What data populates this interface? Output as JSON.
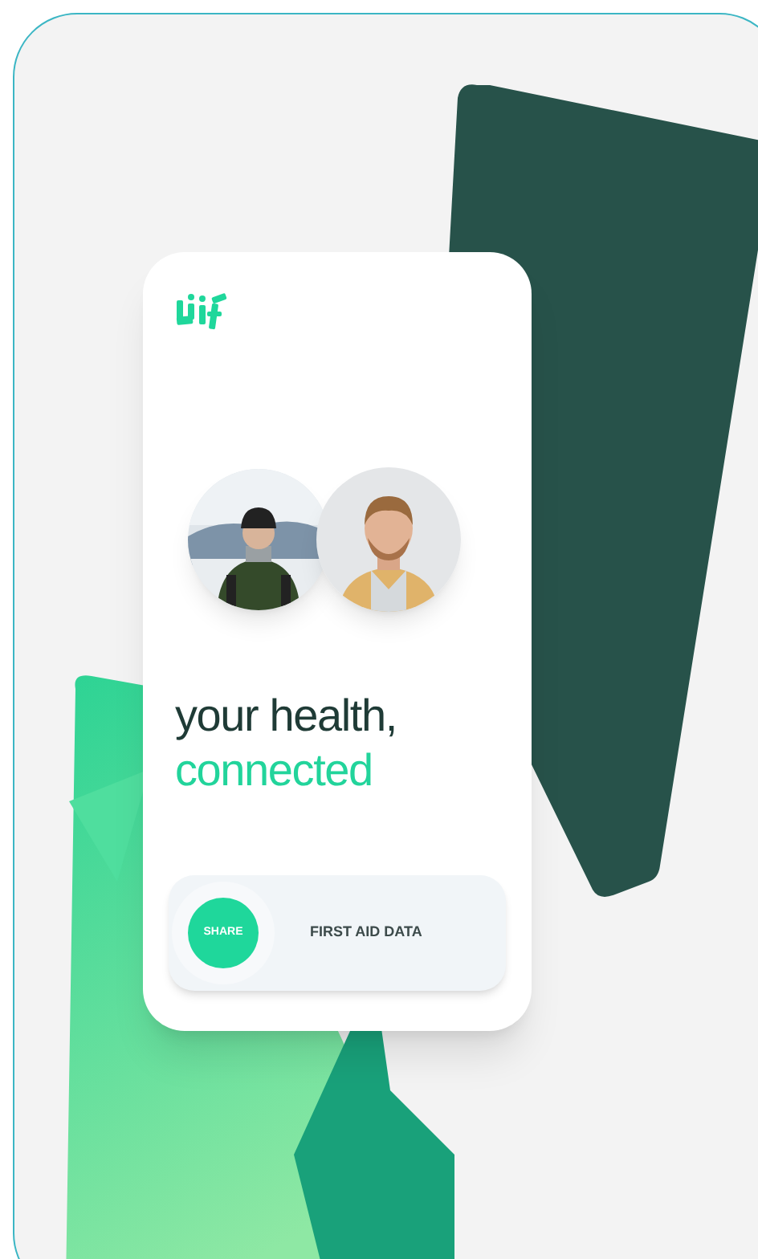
{
  "headline": {
    "line_1": "your health,",
    "line_2": "connected"
  },
  "share_slider": {
    "button": "SHARE",
    "label": "FIRST AID DATA"
  }
}
